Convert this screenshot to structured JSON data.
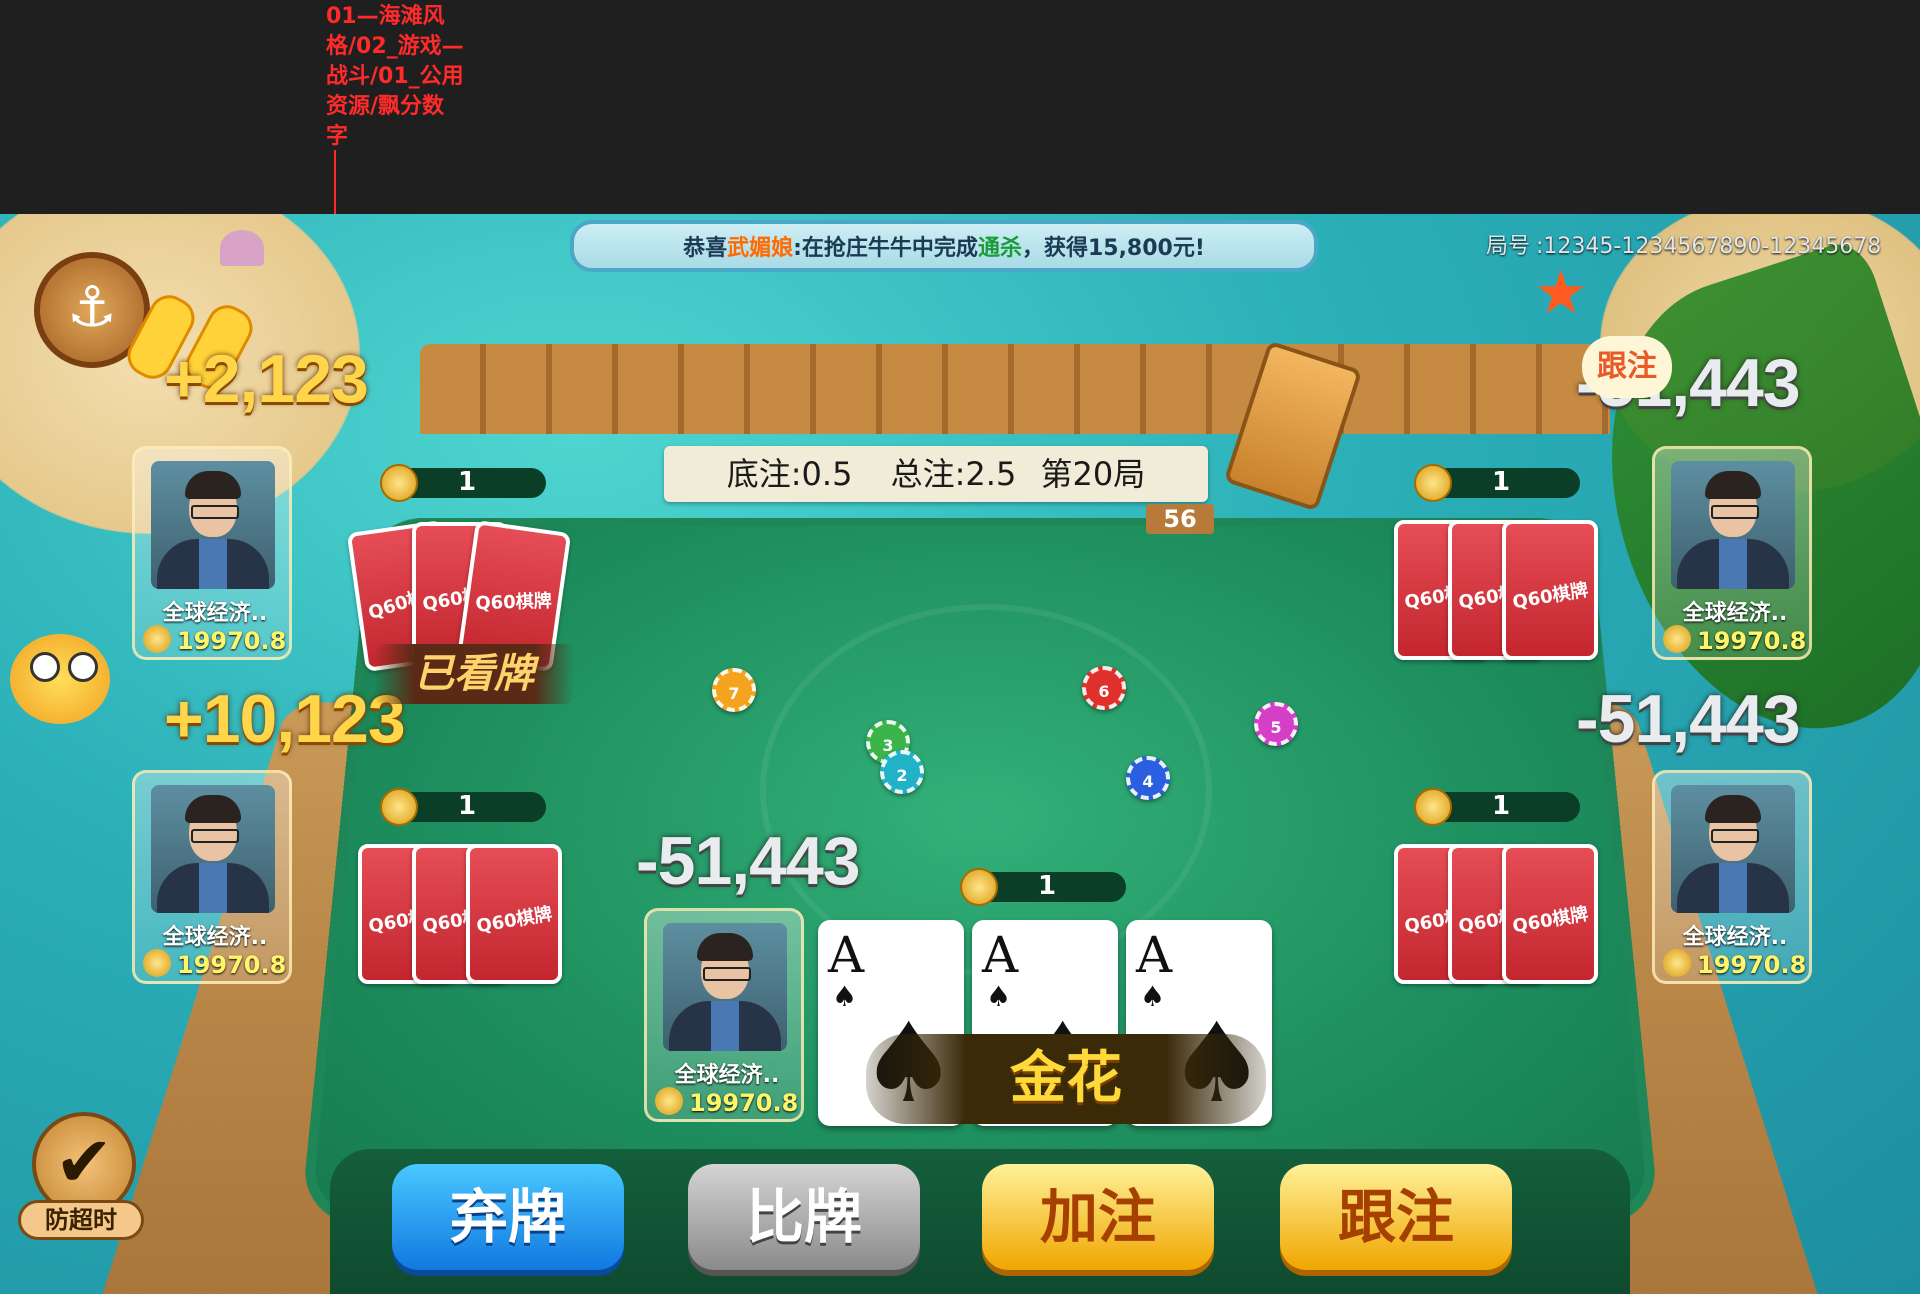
{
  "annotation": {
    "path_text": "01—海滩风格/02_游戏—战斗/01_公用资源/飘分数字"
  },
  "header": {
    "notice_prefix": "恭喜",
    "notice_name": "武媚娘",
    "notice_mid": ":在抢庄牛牛中完成",
    "notice_kill": "通杀",
    "notice_suffix": "，获得15,800元!",
    "round_label": "局号",
    "round_value": ":12345-1234567890-12345678"
  },
  "table_info": {
    "base_bet": "底注:0.5",
    "total_bet": "总注:2.5",
    "round": "第20局"
  },
  "deck_count": "56",
  "speech_bubble": "跟注",
  "seen_badge": "已看牌",
  "hand_badge": "金花",
  "scores": {
    "top_left": "+2,123",
    "mid_left": "+10,123",
    "top_right": "-51,443",
    "mid_right": "-51,443",
    "self": "-51,443"
  },
  "players": [
    {
      "name": "全球经济..",
      "money": "19970.8",
      "bet": "1"
    },
    {
      "name": "全球经济..",
      "money": "19970.8",
      "bet": "1"
    },
    {
      "name": "全球经济..",
      "money": "19970.8",
      "bet": "1"
    },
    {
      "name": "全球经济..",
      "money": "19970.8",
      "bet": "1"
    },
    {
      "name": "全球经济..",
      "money": "19970.8",
      "bet": "1"
    }
  ],
  "card_back_logo": "Q60棋牌",
  "my_cards": [
    {
      "rank": "A",
      "suit": "♠"
    },
    {
      "rank": "A",
      "suit": "♠"
    },
    {
      "rank": "A",
      "suit": "♠"
    }
  ],
  "chips": [
    {
      "label": "7",
      "color": "#f3a31d"
    },
    {
      "label": "3",
      "color": "#3bb54a"
    },
    {
      "label": "2",
      "color": "#21b2c8"
    },
    {
      "label": "6",
      "color": "#e0302b"
    },
    {
      "label": "4",
      "color": "#2a5fe0"
    },
    {
      "label": "5",
      "color": "#d53fc8"
    }
  ],
  "actions": {
    "fold": "弃牌",
    "compare": "比牌",
    "raise": "加注",
    "call": "跟注"
  },
  "timeout_label": "防超时",
  "timeout_icon": "checkmark-icon",
  "anchor_icon": "anchor-icon"
}
